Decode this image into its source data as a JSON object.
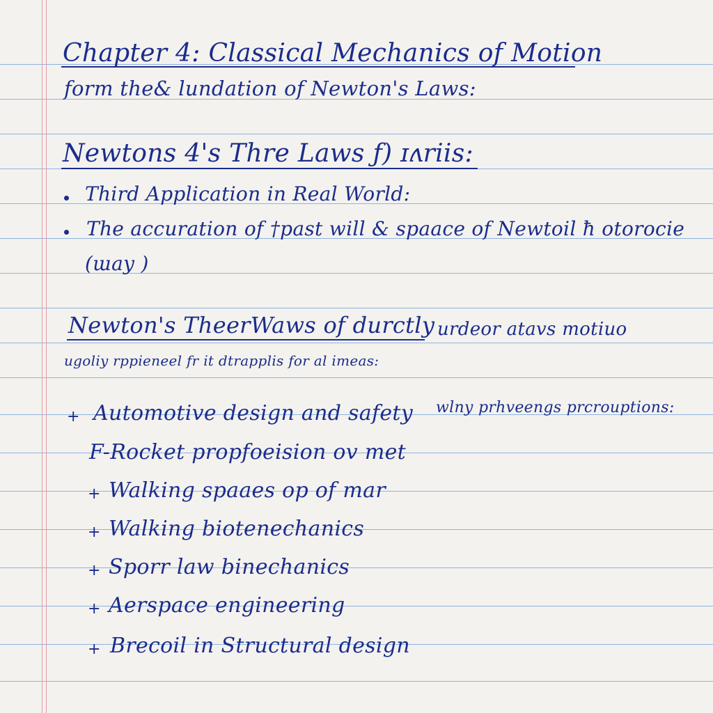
{
  "notes": {
    "title": "Chapter 4: Classical Mechanics of Motion",
    "subtitle": "form the& lundation of  Newton's Laws:",
    "heading_laws": "Newtons 4's Thre Laws ƒ) ɪʌriis:",
    "bullets": [
      "Third Application in Real World:",
      "The accuration of †past will & spaace of Newtoil ħ otorocie",
      "(ɯay )"
    ],
    "heading_motion": "Newton's TheerWaws of durctly",
    "heading_motion_tail": "urdeor  atavs  motiuo",
    "note_line": "ugoliy rppieneel fr it dtrapplis for  al imeas:",
    "applications": [
      {
        "marker": "+",
        "text": "Automotive design  and safety",
        "tail": "wlny  prhveengs  prcrouptions:"
      },
      {
        "marker": "",
        "text": "F-Rocket  propfoeision  ov  met",
        "tail": ""
      },
      {
        "marker": "+",
        "text": "Walking  spaaes  op  of  mar",
        "tail": ""
      },
      {
        "marker": "+",
        "text": "Walking  biotenechanics",
        "tail": ""
      },
      {
        "marker": "+",
        "text": "Sporr  law  binechanics",
        "tail": ""
      },
      {
        "marker": "+",
        "text": "Aerspace  engineering",
        "tail": ""
      },
      {
        "marker": "+",
        "text": "Brecoil  in  Structural  design",
        "tail": ""
      }
    ]
  },
  "colors": {
    "ink": "#1b2c8c",
    "rule": "#8fb3e0",
    "margin": "#e79aa6",
    "paper": "#f3f2ee"
  }
}
